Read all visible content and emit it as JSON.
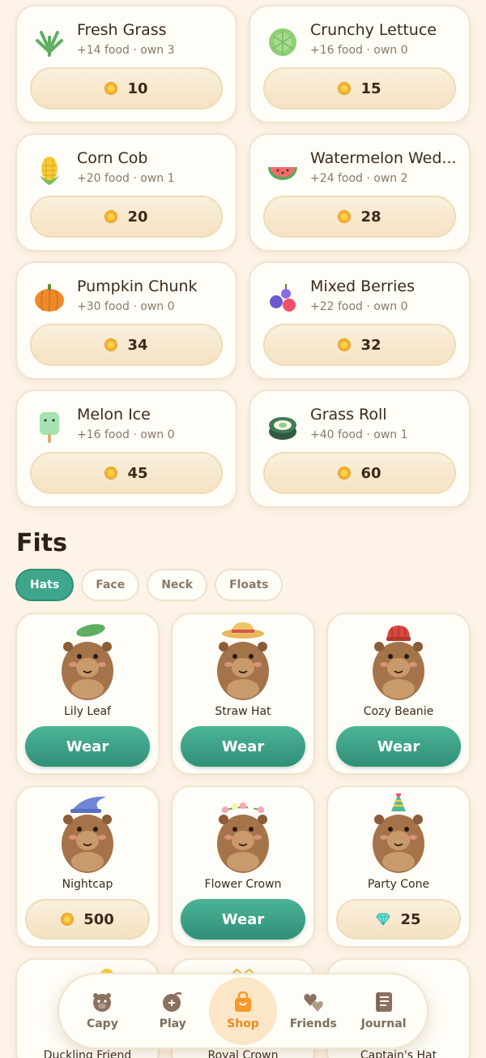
{
  "food": [
    {
      "name": "Fresh Grass",
      "sub": "+14 food · own 3",
      "price": "10",
      "icon": "grass-icon"
    },
    {
      "name": "Crunchy Lettuce",
      "sub": "+16 food · own 0",
      "price": "15",
      "icon": "lettuce-icon"
    },
    {
      "name": "Corn Cob",
      "sub": "+20 food · own 1",
      "price": "20",
      "icon": "corn-icon"
    },
    {
      "name": "Watermelon Wed...",
      "sub": "+24 food · own 2",
      "price": "28",
      "icon": "watermelon-icon"
    },
    {
      "name": "Pumpkin Chunk",
      "sub": "+30 food · own 0",
      "price": "34",
      "icon": "pumpkin-icon"
    },
    {
      "name": "Mixed Berries",
      "sub": "+22 food · own 0",
      "price": "32",
      "icon": "berries-icon"
    },
    {
      "name": "Melon Ice",
      "sub": "+16 food · own 0",
      "price": "45",
      "icon": "popsicle-icon"
    },
    {
      "name": "Grass Roll",
      "sub": "+40 food · own 1",
      "price": "60",
      "icon": "sushi-roll-icon"
    }
  ],
  "fits": {
    "title": "Fits",
    "tabs": [
      "Hats",
      "Face",
      "Neck",
      "Floats"
    ],
    "active_tab": "Hats",
    "items": [
      {
        "name": "Lily Leaf",
        "action": "Wear"
      },
      {
        "name": "Straw Hat",
        "action": "Wear"
      },
      {
        "name": "Cozy Beanie",
        "action": "Wear"
      },
      {
        "name": "Nightcap",
        "price": "500",
        "currency": "coin"
      },
      {
        "name": "Flower Crown",
        "action": "Wear"
      },
      {
        "name": "Party Cone",
        "price": "25",
        "currency": "gem"
      },
      {
        "name": "Duckling Friend"
      },
      {
        "name": "Royal Crown"
      },
      {
        "name": "Captain's Hat"
      }
    ]
  },
  "nav": {
    "items": [
      "Capy",
      "Play",
      "Shop",
      "Friends",
      "Journal"
    ],
    "active": "Shop"
  },
  "colors": {
    "accent": "#3fa68c",
    "active_nav": "#ef8a1e",
    "background": "#fdf3e6"
  }
}
